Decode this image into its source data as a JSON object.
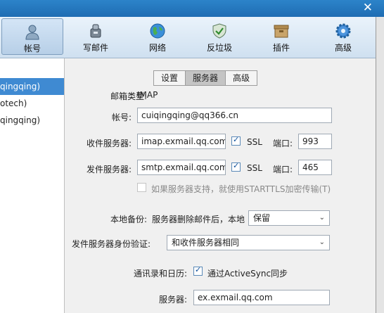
{
  "window": {
    "close_glyph": "✕"
  },
  "toolbar": {
    "items": [
      {
        "label": "帐号",
        "icon": "user-icon",
        "active": true
      },
      {
        "label": "写邮件",
        "icon": "compose-icon"
      },
      {
        "label": "网络",
        "icon": "globe-icon"
      },
      {
        "label": "反垃圾",
        "icon": "shield-icon"
      },
      {
        "label": "插件",
        "icon": "plugin-box-icon"
      },
      {
        "label": "高级",
        "icon": "gear-icon"
      }
    ]
  },
  "sidebar": {
    "accounts": [
      {
        "label": "qingqing)",
        "selected": true
      },
      {
        "label": "otech)"
      },
      {
        "label": "qingqing)"
      }
    ]
  },
  "tabs": [
    "设置",
    "服务器",
    "高级"
  ],
  "active_tab": "服务器",
  "form": {
    "mailbox_type_label": "邮箱类型:",
    "mailbox_type_value": "IMAP",
    "account_label": "帐号:",
    "account_value": "cuiqingqing@qq366.cn",
    "incoming_label": "收件服务器:",
    "incoming_value": "imap.exmail.qq.com",
    "incoming_ssl_label": "SSL",
    "incoming_port_label": "端口:",
    "incoming_port_value": "993",
    "outgoing_label": "发件服务器:",
    "outgoing_value": "smtp.exmail.qq.com",
    "outgoing_ssl_label": "SSL",
    "outgoing_port_label": "端口:",
    "outgoing_port_value": "465",
    "starttls_label": "如果服务器支持，就使用STARTTLS加密传输(T)",
    "backup_label": "本地备份:",
    "backup_desc": "服务器删除邮件后，本地",
    "backup_value": "保留",
    "auth_label": "发件服务器身份验证:",
    "auth_value": "和收件服务器相同",
    "contacts_label": "通讯录和日历:",
    "activesync_label": "通过ActiveSync同步",
    "server_label": "服务器:",
    "server_value": "ex.exmail.qq.com"
  },
  "colors": {
    "accent": "#3f8ad2",
    "titlebar": "#1f6db3"
  }
}
